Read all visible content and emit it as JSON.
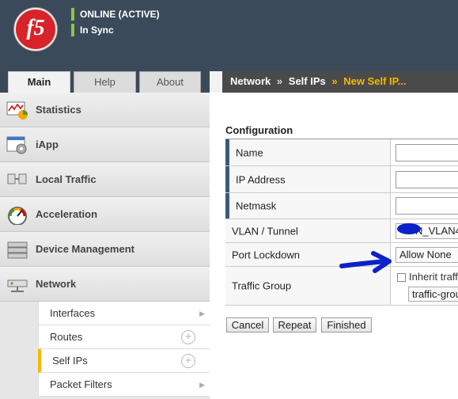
{
  "header": {
    "logo_text": "f5",
    "status_online": "ONLINE (ACTIVE)",
    "status_sync": "In Sync",
    "status_color": "#8cc63f"
  },
  "tabs": [
    {
      "label": "Main",
      "active": true
    },
    {
      "label": "Help",
      "active": false
    },
    {
      "label": "About",
      "active": false
    }
  ],
  "breadcrumb": {
    "items": [
      "Network",
      "Self IPs"
    ],
    "separator": "»",
    "current": "New Self IP..."
  },
  "sidebar": {
    "items": [
      {
        "label": "Statistics",
        "icon": "statistics-icon"
      },
      {
        "label": "iApp",
        "icon": "iapp-icon"
      },
      {
        "label": "Local Traffic",
        "icon": "local-traffic-icon"
      },
      {
        "label": "Acceleration",
        "icon": "acceleration-icon"
      },
      {
        "label": "Device Management",
        "icon": "device-management-icon"
      },
      {
        "label": "Network",
        "icon": "network-icon"
      }
    ],
    "subitems": [
      {
        "label": "Interfaces",
        "has_add": false,
        "has_chevron": true,
        "active": false
      },
      {
        "label": "Routes",
        "has_add": true,
        "has_chevron": false,
        "active": false
      },
      {
        "label": "Self IPs",
        "has_add": true,
        "has_chevron": false,
        "active": true
      },
      {
        "label": "Packet Filters",
        "has_add": false,
        "has_chevron": true,
        "active": false
      }
    ],
    "add_glyph": "+",
    "chevron_glyph": "▶"
  },
  "configuration": {
    "title": "Configuration",
    "fields": [
      {
        "label": "Name",
        "value": ""
      },
      {
        "label": "IP Address",
        "value": ""
      },
      {
        "label": "Netmask",
        "value": ""
      },
      {
        "label": "VLAN / Tunnel",
        "value": "N_VLAN4"
      },
      {
        "label": "Port Lockdown",
        "value": "Allow None"
      },
      {
        "label": "Traffic Group",
        "checkbox_label": "Inherit traff",
        "select_value": "traffic-grou"
      }
    ]
  },
  "buttons": {
    "cancel": "Cancel",
    "repeat": "Repeat",
    "finished": "Finished"
  },
  "colors": {
    "header_bg": "#3b4a5a",
    "breadcrumb_current": "#f5b800",
    "annotation": "#0a22c8"
  }
}
